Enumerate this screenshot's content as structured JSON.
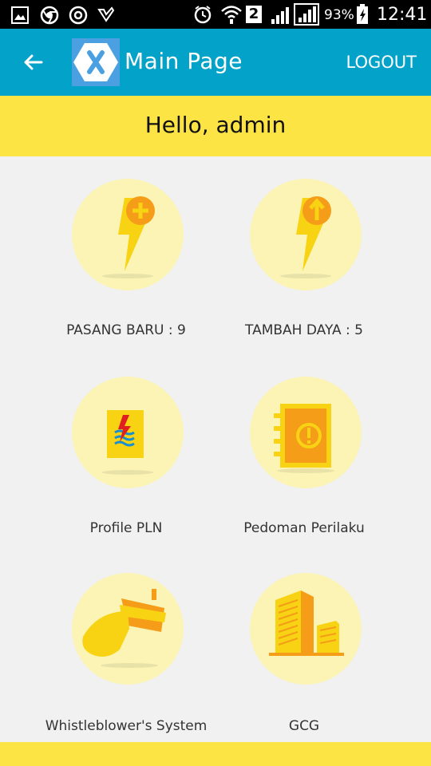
{
  "status_bar": {
    "battery": "93%",
    "sim_slot": "2",
    "time": "12:41"
  },
  "app_bar": {
    "title": "Main Page",
    "logout_label": "LOGOUT"
  },
  "greeting": "Hello, admin",
  "menu": [
    {
      "label": "PASANG BARU : 9",
      "icon": "lightning-plus-icon"
    },
    {
      "label": "TAMBAH DAYA : 5",
      "icon": "lightning-up-arrow-icon"
    },
    {
      "label": "Profile PLN",
      "icon": "pln-logo-icon"
    },
    {
      "label": "Pedoman Perilaku",
      "icon": "notebook-icon"
    },
    {
      "label": "Whistleblower's System",
      "icon": "whistle-icon"
    },
    {
      "label": "GCG",
      "icon": "buildings-icon"
    }
  ],
  "colors": {
    "app_bar": "#03a2c9",
    "greeting_bar": "#fde445",
    "icon_circle": "#fbf4b4",
    "icon_yellow": "#f7d313",
    "icon_orange": "#f59d18"
  }
}
